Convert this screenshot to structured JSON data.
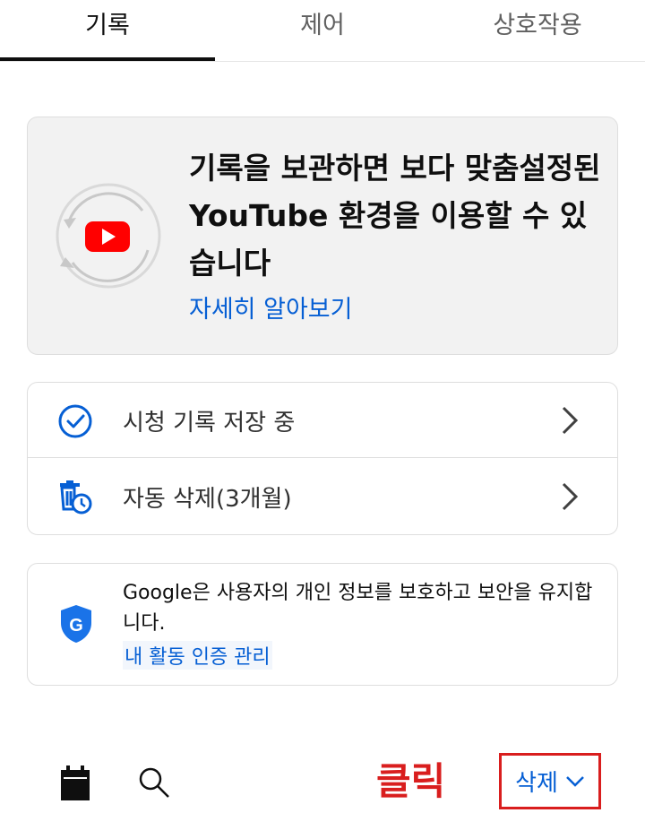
{
  "tabs": [
    {
      "label": "기록",
      "active": true
    },
    {
      "label": "제어",
      "active": false
    },
    {
      "label": "상호작용",
      "active": false
    }
  ],
  "promo": {
    "title": "기록을 보관하면 보다 맞춤설정된 YouTube 환경을 이용할 수 있습니다",
    "link": "자세히 알아보기",
    "icon": "youtube-history-icon"
  },
  "settings": [
    {
      "label": "시청 기록 저장 중",
      "icon": "check-circle-icon"
    },
    {
      "label": "자동 삭제(3개월)",
      "icon": "auto-delete-icon"
    }
  ],
  "security": {
    "text": "Google은 사용자의 개인 정보를 보호하고 보안을 유지합니다.",
    "link": "내 활동 인증 관리",
    "icon": "google-shield-icon"
  },
  "bottom_bar": {
    "annotation": "클릭",
    "delete_label": "삭제",
    "icons": [
      "calendar-icon",
      "search-icon"
    ]
  },
  "colors": {
    "accent": "#065fd4",
    "youtube_red": "#ff0000",
    "annotation_red": "#d91e1e"
  }
}
